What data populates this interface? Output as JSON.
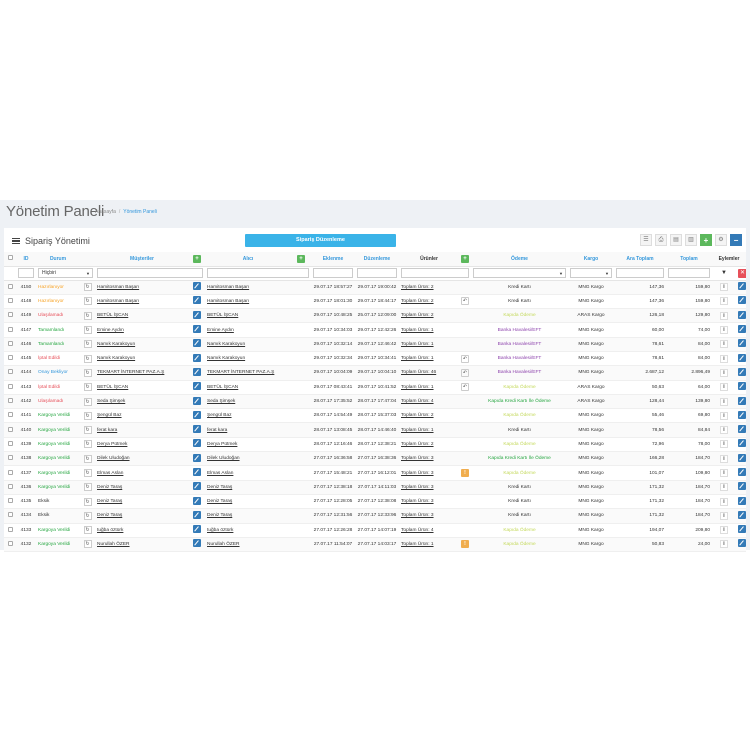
{
  "page": {
    "title": "Yönetim Paneli",
    "breadcrumb": [
      "Anasayfa",
      "Yönetim Paneli"
    ],
    "card_title": "Sipariş Yönetimi",
    "bulk_button": "Sipariş Düzenleme"
  },
  "toolbar": [
    "list-icon",
    "print-icon",
    "export-icon",
    "trash-icon",
    "add-icon",
    "settings-icon",
    "collapse-icon"
  ],
  "table": {
    "columns": [
      "ID",
      "Durum",
      "Müşteriler",
      "Alıcı",
      "Eklenme",
      "Düzenleme",
      "Ürünler",
      "Ödeme",
      "Kargo",
      "Ara Toplam",
      "Toplam",
      "Eylemler"
    ],
    "filter_status": "Hiçbiri",
    "rows": [
      {
        "id": "4150",
        "status": "Hazırlanıyor",
        "status_color": "#f7a326",
        "customer": "Hamitosman Başarı",
        "receiver": "Hamitosman Başarı",
        "added": "29.07.17 18:57:27",
        "edited": "29.07.17 19:00:42",
        "products": "Toplam Ürün: 2",
        "undo": false,
        "warn": false,
        "payment": "Kredi Kartı",
        "payment_color": "#333333",
        "cargo": "MNG Kargo",
        "subtotal": "147,36",
        "total": "159,80"
      },
      {
        "id": "4148",
        "status": "Hazırlanıyor",
        "status_color": "#f7a326",
        "customer": "Hamitosman Başarı",
        "receiver": "Hamitosman Başarı",
        "added": "29.07.17 18:01:30",
        "edited": "29.07.17 18:44:17",
        "products": "Toplam Ürün: 2",
        "undo": true,
        "warn": false,
        "payment": "Kredi Kartı",
        "payment_color": "#333333",
        "cargo": "MNG Kargo",
        "subtotal": "147,36",
        "total": "159,80"
      },
      {
        "id": "4149",
        "status": "Ulaşılamadı",
        "status_color": "#e7505a",
        "customer": "BETÜL İŞCAN",
        "receiver": "BETÜL İŞCAN",
        "added": "29.07.17 10:48:25",
        "edited": "25.07.17 12:09:00",
        "products": "Toplam Ürün: 2",
        "undo": false,
        "warn": false,
        "payment": "Kapıda Ödeme",
        "payment_color": "#c4d95c",
        "cargo": "ARAS Kargo",
        "subtotal": "126,18",
        "total": "129,80"
      },
      {
        "id": "4147",
        "status": "Tamamlandı",
        "status_color": "#26a641",
        "customer": "Emine Aydın",
        "receiver": "Emine Aydın",
        "added": "29.07.17 10:34:03",
        "edited": "29.07.17 12:42:26",
        "products": "Toplam Ürün: 1",
        "undo": false,
        "warn": false,
        "payment": "Banka Havalesi/EFT",
        "payment_color": "#8e44ad",
        "cargo": "MNG Kargo",
        "subtotal": "60,00",
        "total": "74,00"
      },
      {
        "id": "4146",
        "status": "Tamamlandı",
        "status_color": "#26a641",
        "customer": "Namık Karakoyun",
        "receiver": "Namık Karakoyun",
        "added": "29.07.17 10:32:14",
        "edited": "29.07.17 12:46:42",
        "products": "Toplam Ürün: 1",
        "undo": false,
        "warn": false,
        "payment": "Banka Havalesi/EFT",
        "payment_color": "#8e44ad",
        "cargo": "MNG Kargo",
        "subtotal": "78,61",
        "total": "84,00"
      },
      {
        "id": "4145",
        "status": "İptal Edildi",
        "status_color": "#e7505a",
        "customer": "Namık Karakoyun",
        "receiver": "Namık Karakoyun",
        "added": "29.07.17 10:32:34",
        "edited": "29.07.17 10:34:41",
        "products": "Toplam Ürün: 1",
        "undo": true,
        "warn": false,
        "payment": "Banka Havalesi/EFT",
        "payment_color": "#8e44ad",
        "cargo": "MNG Kargo",
        "subtotal": "78,61",
        "total": "84,00"
      },
      {
        "id": "4144",
        "status": "Onay Bekliyor",
        "status_color": "#3598dc",
        "customer": "TEKMART İNTERNET PAZ.A.Ş",
        "receiver": "TEKMART İNTERNET PAZ.A.Ş",
        "added": "29.07.17 10:04:09",
        "edited": "29.07.17 10:04:10",
        "products": "Toplam Ürün: 46",
        "undo": true,
        "warn": false,
        "payment": "Banka Havalesi/EFT",
        "payment_color": "#8e44ad",
        "cargo": "MNG Kargo",
        "subtotal": "2.687,12",
        "total": "2.896,49"
      },
      {
        "id": "4143",
        "status": "İptal Edildi",
        "status_color": "#e7505a",
        "customer": "BETÜL İŞCAN",
        "receiver": "BETÜL İŞCAN",
        "added": "29.07.17 08:43:41",
        "edited": "29.07.17 10:41:52",
        "products": "Toplam Ürün: 1",
        "undo": true,
        "warn": false,
        "payment": "Kapıda Ödeme",
        "payment_color": "#c4d95c",
        "cargo": "ARAS Kargo",
        "subtotal": "50,63",
        "total": "64,00"
      },
      {
        "id": "4142",
        "status": "Ulaşılamadı",
        "status_color": "#e7505a",
        "customer": "Seda Şimşek",
        "receiver": "Seda Şimşek",
        "added": "28.07.17 17:35:52",
        "edited": "28.07.17 17:47:04",
        "products": "Toplam Ürün: 4",
        "undo": false,
        "warn": false,
        "payment": "Kapıda Kredi Kartı İle Ödeme",
        "payment_color": "#26a641",
        "cargo": "ARAS Kargo",
        "subtotal": "128,44",
        "total": "139,80"
      },
      {
        "id": "4141",
        "status": "Kargoya Verildi",
        "status_color": "#26a641",
        "customer": "Şengül Baz",
        "receiver": "Şengül Baz",
        "added": "28.07.17 14:54:49",
        "edited": "28.07.17 15:37:03",
        "products": "Toplam Ürün: 2",
        "undo": false,
        "warn": false,
        "payment": "Kapıda Ödeme",
        "payment_color": "#c4d95c",
        "cargo": "MNG Kargo",
        "subtotal": "55,46",
        "total": "69,80"
      },
      {
        "id": "4140",
        "status": "Kargoya Verildi",
        "status_color": "#26a641",
        "customer": "ferat kara",
        "receiver": "ferat kara",
        "added": "28.07.17 13:08:45",
        "edited": "28.07.17 14:46:40",
        "products": "Toplam Ürün: 1",
        "undo": false,
        "warn": false,
        "payment": "Kredi Kartı",
        "payment_color": "#333333",
        "cargo": "MNG Kargo",
        "subtotal": "78,56",
        "total": "84,84"
      },
      {
        "id": "4139",
        "status": "Kargoya Verildi",
        "status_color": "#26a641",
        "customer": "Derya Pütmek",
        "receiver": "Derya Pütmek",
        "added": "28.07.17 12:16:46",
        "edited": "28.07.17 12:38:21",
        "products": "Toplam Ürün: 2",
        "undo": false,
        "warn": false,
        "payment": "Kapıda Ödeme",
        "payment_color": "#c4d95c",
        "cargo": "MNG Kargo",
        "subtotal": "72,96",
        "total": "78,00"
      },
      {
        "id": "4138",
        "status": "Kargoya Verildi",
        "status_color": "#26a641",
        "customer": "Dilek Uludoğan",
        "receiver": "Dilek Uludoğan",
        "added": "27.07.17 16:36:58",
        "edited": "27.07.17 16:38:36",
        "products": "Toplam Ürün: 3",
        "undo": false,
        "warn": false,
        "payment": "Kapıda Kredi Kartı İle Ödeme",
        "payment_color": "#26a641",
        "cargo": "MNG Kargo",
        "subtotal": "166,28",
        "total": "184,70"
      },
      {
        "id": "4137",
        "status": "Kargoya Verildi",
        "status_color": "#26a641",
        "customer": "Elmas Aslan",
        "receiver": "Elmas Aslan",
        "added": "27.07.17 15:48:21",
        "edited": "27.07.17 16:12:01",
        "products": "Toplam Ürün: 3",
        "undo": false,
        "warn": true,
        "payment": "Kapıda Ödeme",
        "payment_color": "#c4d95c",
        "cargo": "MNG Kargo",
        "subtotal": "101,07",
        "total": "109,80"
      },
      {
        "id": "4136",
        "status": "Kargoya Verildi",
        "status_color": "#26a641",
        "customer": "Deniz Taraş",
        "receiver": "Deniz Taraş",
        "added": "27.07.17 12:38:18",
        "edited": "27.07.17 14:11:03",
        "products": "Toplam Ürün: 3",
        "undo": false,
        "warn": false,
        "payment": "Kredi Kartı",
        "payment_color": "#333333",
        "cargo": "MNG Kargo",
        "subtotal": "171,32",
        "total": "184,70"
      },
      {
        "id": "4135",
        "status": "Eksik",
        "status_color": "#333333",
        "customer": "Deniz Taraş",
        "receiver": "Deniz Taraş",
        "added": "27.07.17 12:28:05",
        "edited": "27.07.17 12:38:08",
        "products": "Toplam Ürün: 3",
        "undo": false,
        "warn": false,
        "payment": "Kredi Kartı",
        "payment_color": "#333333",
        "cargo": "MNG Kargo",
        "subtotal": "171,32",
        "total": "184,70"
      },
      {
        "id": "4134",
        "status": "Eksik",
        "status_color": "#333333",
        "customer": "Deniz Taraş",
        "receiver": "Deniz Taraş",
        "added": "27.07.17 12:31:56",
        "edited": "27.07.17 12:33:96",
        "products": "Toplam Ürün: 3",
        "undo": false,
        "warn": false,
        "payment": "Kredi Kartı",
        "payment_color": "#333333",
        "cargo": "MNG Kargo",
        "subtotal": "171,32",
        "total": "184,70"
      },
      {
        "id": "4133",
        "status": "Kargoya Verildi",
        "status_color": "#26a641",
        "customer": "tuğba öztürk",
        "receiver": "tuğba öztürk",
        "added": "27.07.17 12:26:28",
        "edited": "27.07.17 14:07:19",
        "products": "Toplam Ürün: 4",
        "undo": false,
        "warn": false,
        "payment": "Kapıda Ödeme",
        "payment_color": "#c4d95c",
        "cargo": "MNG Kargo",
        "subtotal": "194,07",
        "total": "209,80"
      },
      {
        "id": "4132",
        "status": "Kargoya Verildi",
        "status_color": "#26a641",
        "customer": "Nurullah ÖZER",
        "receiver": "Nurullah ÖZER",
        "added": "27.07.17 11:54:07",
        "edited": "27.07.17 14:03:17",
        "products": "Toplam Ürün: 1",
        "undo": false,
        "warn": true,
        "payment": "Kapıda Ödeme",
        "payment_color": "#c4d95c",
        "cargo": "MNG Kargo",
        "subtotal": "50,83",
        "total": "24,00"
      }
    ]
  }
}
